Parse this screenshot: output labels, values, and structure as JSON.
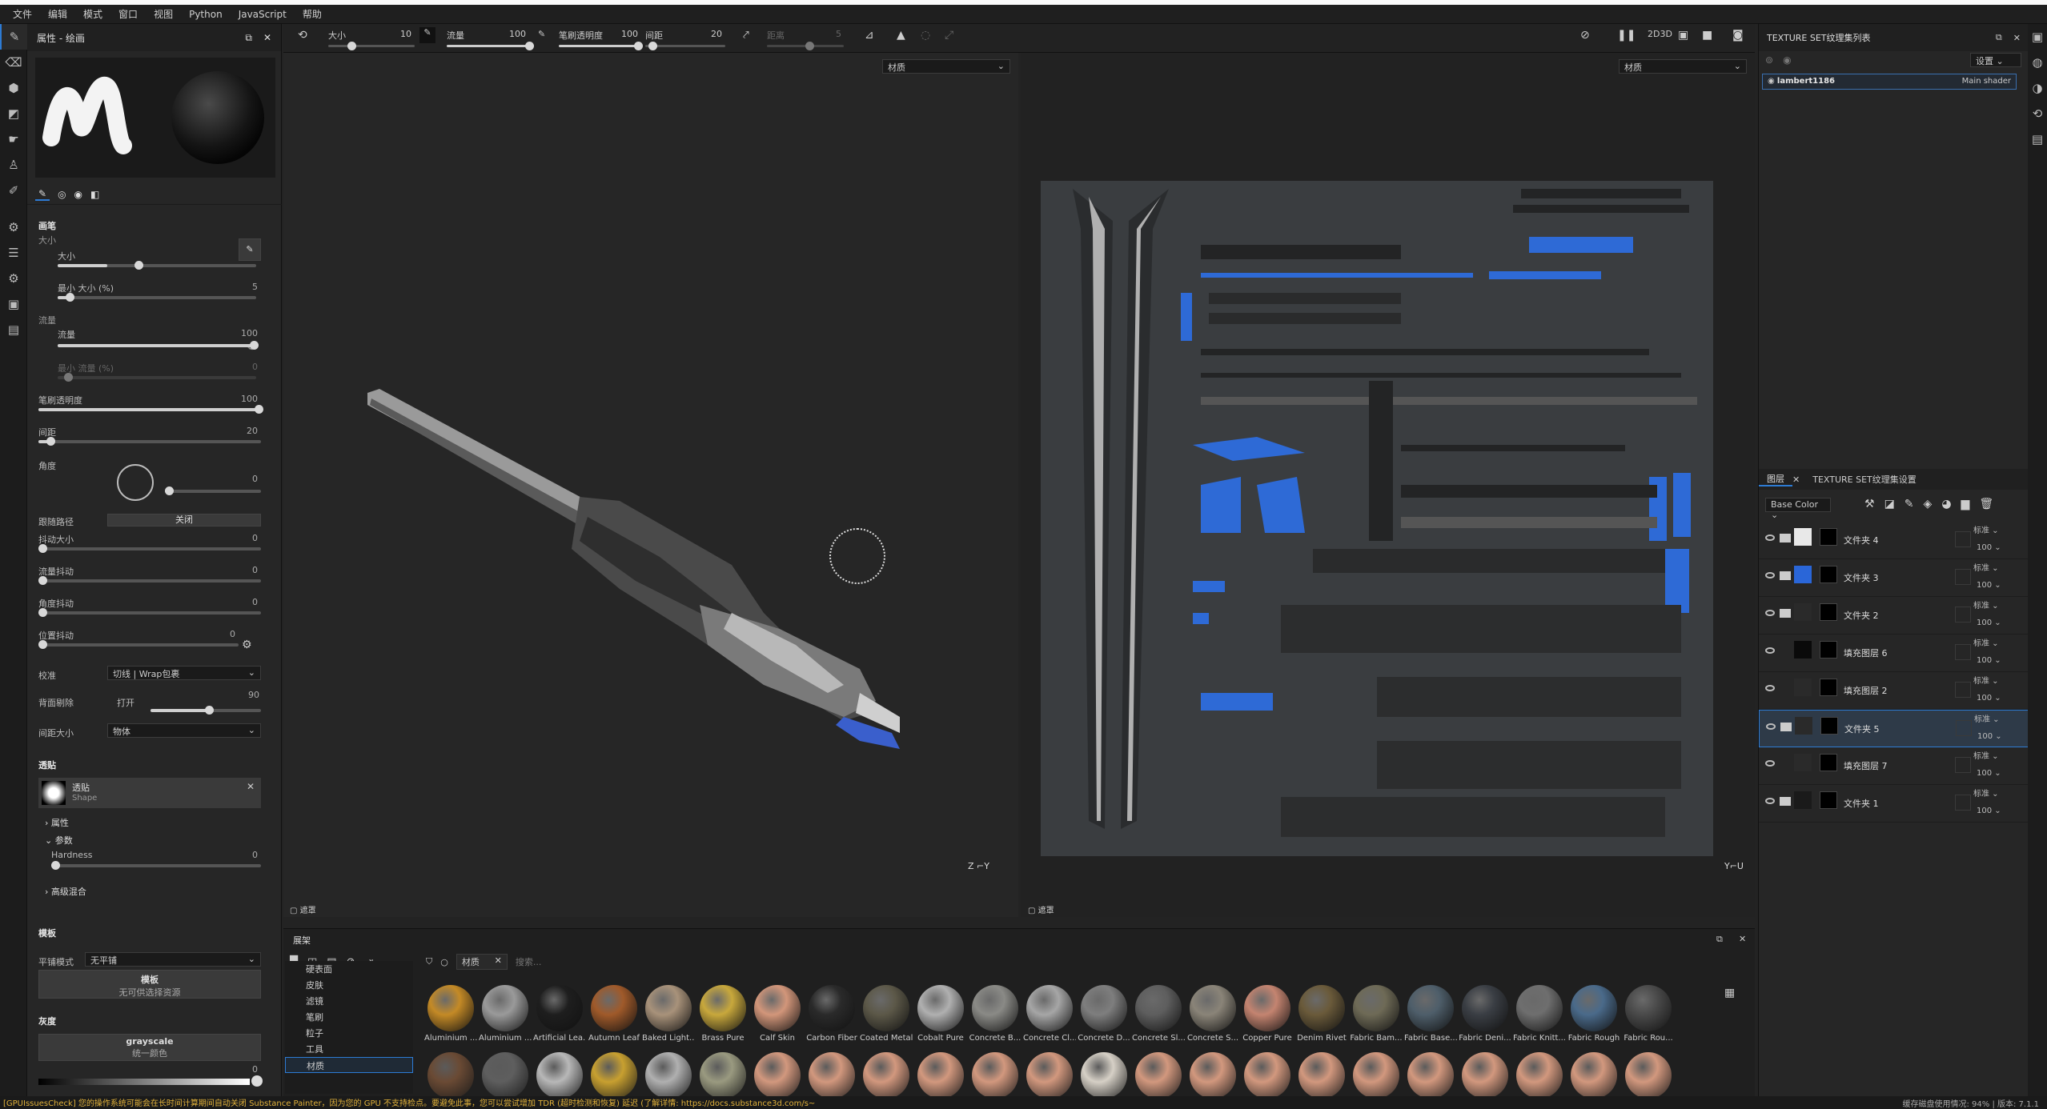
{
  "menu": [
    "文件",
    "编辑",
    "模式",
    "窗口",
    "视图",
    "Python",
    "JavaScript",
    "帮助"
  ],
  "props": {
    "title": "属性 - 绘画",
    "section_brush": "画笔",
    "size_label": "大小",
    "size_label2": "大小",
    "size_value": "10",
    "min_size_label": "最小 大小 (%)",
    "min_size_value": "5",
    "flow_section": "流量",
    "flow_label": "流量",
    "flow_value": "100",
    "min_flow_label": "最小 流量 (%)",
    "min_flow_value": "0",
    "stroke_opacity_label": "笔刷透明度",
    "stroke_opacity_value": "100",
    "spacing_label": "间距",
    "spacing_value": "20",
    "angle_label": "角度",
    "angle_value": "0",
    "follow_path_label": "跟随路径",
    "follow_path_value": "关闭",
    "jitter_size_label": "抖动大小",
    "jitter_size_value": "0",
    "jitter_flow_label": "流量抖动",
    "jitter_flow_value": "0",
    "jitter_angle_label": "角度抖动",
    "jitter_angle_value": "0",
    "jitter_pos_label": "位置抖动",
    "jitter_pos_value": "0",
    "alignment_label": "校准",
    "alignment_value": "切线 | Wrap包裹",
    "backface_label": "背面剔除",
    "backface_on": "打开",
    "backface_value": "90",
    "spacing_size_label": "间距大小",
    "spacing_size_value": "物体",
    "alpha_section": "透贴",
    "alpha_name": "透贴",
    "alpha_sub": "Shape",
    "attr_label": "属性",
    "params_label": "参数",
    "hardness_label": "Hardness",
    "hardness_value": "0",
    "advanced_label": "高级混合",
    "stencil_section": "模板",
    "tiling_label": "平铺模式",
    "tiling_value": "无平铺",
    "stencil_btn_1": "模板",
    "stencil_btn_2": "无可供选择资源",
    "gray_section": "灰度",
    "gray_btn_1": "grayscale",
    "gray_btn_2": "统一颜色",
    "gray_value": "0"
  },
  "viewport_toolbar": {
    "size_label": "大小",
    "size_value": "10",
    "flow_label": "流量",
    "flow_value": "100",
    "opacity_label": "笔刷透明度",
    "opacity_value": "100",
    "spacing_label": "间距",
    "spacing_value": "20",
    "dist_label": "距离",
    "dist_value": "5"
  },
  "viewport3d": {
    "dropdown": "材质",
    "mask_label": "遮罩"
  },
  "viewport2d": {
    "dropdown": "材质",
    "mask_label": "遮罩"
  },
  "shelf": {
    "title": "展架",
    "filter_tag": "材质",
    "search_placeholder": "搜索...",
    "categories": [
      "硬表面",
      "皮肤",
      "滤镜",
      "笔刷",
      "粒子",
      "工具",
      "材质"
    ],
    "materials": [
      {
        "name": "Aluminium ...",
        "color": "#c48a26"
      },
      {
        "name": "Aluminium ...",
        "color": "#9a9a9a"
      },
      {
        "name": "Artificial Lea...",
        "color": "#1e1e1e"
      },
      {
        "name": "Autumn Leaf",
        "color": "#a05a2a"
      },
      {
        "name": "Baked Light...",
        "color": "#a8927a"
      },
      {
        "name": "Brass Pure",
        "color": "#c8a83c"
      },
      {
        "name": "Calf Skin",
        "color": "#d2967a"
      },
      {
        "name": "Carbon Fiber",
        "color": "#2a2a2a"
      },
      {
        "name": "Coated Metal",
        "color": "#5c5848"
      },
      {
        "name": "Cobalt Pure",
        "color": "#b0b0b0"
      },
      {
        "name": "Concrete B...",
        "color": "#8a8a86"
      },
      {
        "name": "Concrete Cl...",
        "color": "#a6a6a6"
      },
      {
        "name": "Concrete D...",
        "color": "#7e7e7e"
      },
      {
        "name": "Concrete Sl...",
        "color": "#5e5e5e"
      },
      {
        "name": "Concrete S...",
        "color": "#8a8478"
      },
      {
        "name": "Copper Pure",
        "color": "#c48470"
      },
      {
        "name": "Denim Rivet",
        "color": "#6a5a3a"
      },
      {
        "name": "Fabric Bam...",
        "color": "#6e6a56"
      },
      {
        "name": "Fabric Base...",
        "color": "#4e5e6a"
      },
      {
        "name": "Fabric Deni...",
        "color": "#3a3e44"
      },
      {
        "name": "Fabric Knitt...",
        "color": "#6e6e6e"
      },
      {
        "name": "Fabric Rough",
        "color": "#4a6a8a"
      },
      {
        "name": "Fabric Rou...",
        "color": "#4a4a4a"
      }
    ],
    "row2_colors": [
      "#6a4a34",
      "#5e5e5e",
      "#b8b8b8",
      "#c8a030",
      "#b0b0b0",
      "#9a9a80",
      "#d2987e",
      "#d2987e",
      "#d2987e",
      "#d2987e",
      "#d2987e",
      "#d2987e",
      "#d6d0c6",
      "#d2987e",
      "#d2987e",
      "#d2987e",
      "#d2987e",
      "#d2987e",
      "#d2987e",
      "#d2987e",
      "#d2987e",
      "#d2987e",
      "#d2987e"
    ]
  },
  "texture_set_list": {
    "title": "TEXTURE SET纹理集列表",
    "settings_btn": "设置",
    "item_name": "lambert1186",
    "item_shader": "Main shader"
  },
  "layers_panel": {
    "tab_layers": "图层",
    "tab_settings": "TEXTURE SET纹理集设置",
    "channel": "Base Color",
    "layers": [
      {
        "name": "文件夹 4",
        "type": "folder",
        "thumb": "#e8e8e8",
        "blend": "标准",
        "opacity": "100"
      },
      {
        "name": "文件夹 3",
        "type": "folder",
        "thumb": "#2a66d8",
        "blend": "标准",
        "opacity": "100"
      },
      {
        "name": "文件夹 2",
        "type": "folder",
        "thumb": "#2a2a2a",
        "blend": "标准",
        "opacity": "100"
      },
      {
        "name": "填充图层 6",
        "type": "fill",
        "thumb": "#0a0a0a",
        "blend": "标准",
        "opacity": "100"
      },
      {
        "name": "填充图层 2",
        "type": "fill",
        "thumb": "#2a2a2a",
        "blend": "标准",
        "opacity": "100"
      },
      {
        "name": "文件夹 5",
        "type": "folder",
        "thumb": "#2a2a2a",
        "blend": "标准",
        "opacity": "100"
      },
      {
        "name": "填充图层 7",
        "type": "fill",
        "thumb": "#2a2a2a",
        "blend": "标准",
        "opacity": "100"
      },
      {
        "name": "文件夹 1",
        "type": "folder",
        "thumb": "#1a1a1a",
        "blend": "标准",
        "opacity": "100"
      }
    ]
  },
  "status": {
    "message": "[GPUIssuesCheck] 您的操作系统可能会在长时间计算期间自动关闭 Substance Painter，因为您的 GPU 不支持检点。要避免此事，您可以尝试增加 TDR (超时检测和恢复) 延迟 (了解详情: https://docs.substance3d.com/s~",
    "right": "缓存磁盘使用情况:    94%  |  版本:  7.1.1"
  },
  "colors": {
    "accent": "#2d7bd4",
    "selected_layer": "#2e3a48"
  }
}
